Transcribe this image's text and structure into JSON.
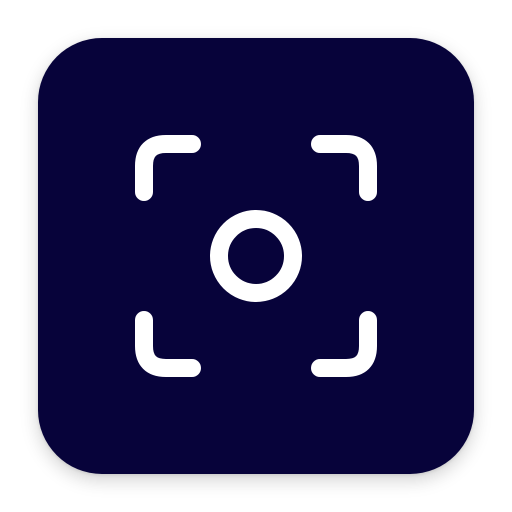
{
  "app_icon": {
    "name": "focus-camera-app-icon",
    "glyph_icon": "viewfinder-focus-icon",
    "background_color": "#07033a",
    "glyph_color": "#ffffff"
  }
}
